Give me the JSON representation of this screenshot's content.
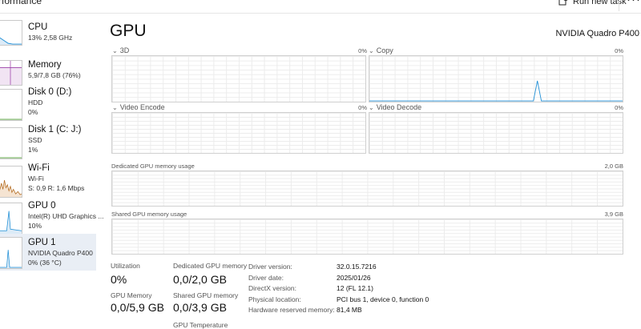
{
  "header": {
    "app_title": "rformance",
    "run_new_task": "Run new task",
    "more": "···"
  },
  "sidebar": {
    "items": [
      {
        "title": "CPU",
        "sub1": "13% 2,58 GHz",
        "sub2": "",
        "sub3": "",
        "color": "#1f8fd6"
      },
      {
        "title": "Memory",
        "sub1": "5,9/7,8 GB (76%)",
        "sub2": "",
        "sub3": "",
        "color": "#9b3fa8"
      },
      {
        "title": "Disk 0 (D:)",
        "sub1": "HDD",
        "sub2": "0%",
        "sub3": "",
        "color": "#4a9a2c"
      },
      {
        "title": "Disk 1 (C: J:)",
        "sub1": "SSD",
        "sub2": "1%",
        "sub3": "",
        "color": "#4a9a2c"
      },
      {
        "title": "Wi-Fi",
        "sub1": "Wi-Fi",
        "sub2": "S: 0,9  R: 1,6 Mbps",
        "sub3": "",
        "color": "#b36a1e"
      },
      {
        "title": "GPU 0",
        "sub1": "Intel(R) UHD Graphics ...",
        "sub2": "10%",
        "sub3": "",
        "color": "#1f8fd6"
      },
      {
        "title": "GPU 1",
        "sub1": "NVIDIA Quadro P400",
        "sub2": "0% (36 °C)",
        "sub3": "",
        "color": "#1f8fd6",
        "selected": true
      }
    ]
  },
  "main": {
    "title": "GPU",
    "device": "NVIDIA Quadro P400",
    "engines": [
      {
        "label": "3D",
        "pct": "0%"
      },
      {
        "label": "Copy",
        "pct": "0%"
      },
      {
        "label": "Video Encode",
        "pct": "0%"
      },
      {
        "label": "Video Decode",
        "pct": "0%"
      }
    ],
    "dedicated_label": "Dedicated GPU memory usage",
    "dedicated_max": "2,0 GB",
    "shared_label": "Shared GPU memory usage",
    "shared_max": "3,9 GB",
    "stats": {
      "utilization_label": "Utilization",
      "utilization_value": "0%",
      "dedicated_mem_label": "Dedicated GPU memory",
      "dedicated_mem_value": "0,0/2,0 GB",
      "gpu_memory_label": "GPU Memory",
      "gpu_memory_value": "0,0/5,9 GB",
      "shared_mem_label": "Shared GPU memory",
      "shared_mem_value": "0,0/3,9 GB",
      "gpu_temp_label": "GPU Temperature"
    },
    "info": [
      {
        "key": "Driver version:",
        "value": "32.0.15.7216"
      },
      {
        "key": "Driver date:",
        "value": "2025/01/26"
      },
      {
        "key": "DirectX version:",
        "value": "12 (FL 12.1)"
      },
      {
        "key": "Physical location:",
        "value": "PCI bus 1, device 0, function 0"
      },
      {
        "key": "Hardware reserved memory:",
        "value": "81,4 MB"
      }
    ]
  },
  "colors": {
    "accent_blue": "#1f8fd6",
    "selected_bg": "#e9eef5"
  }
}
